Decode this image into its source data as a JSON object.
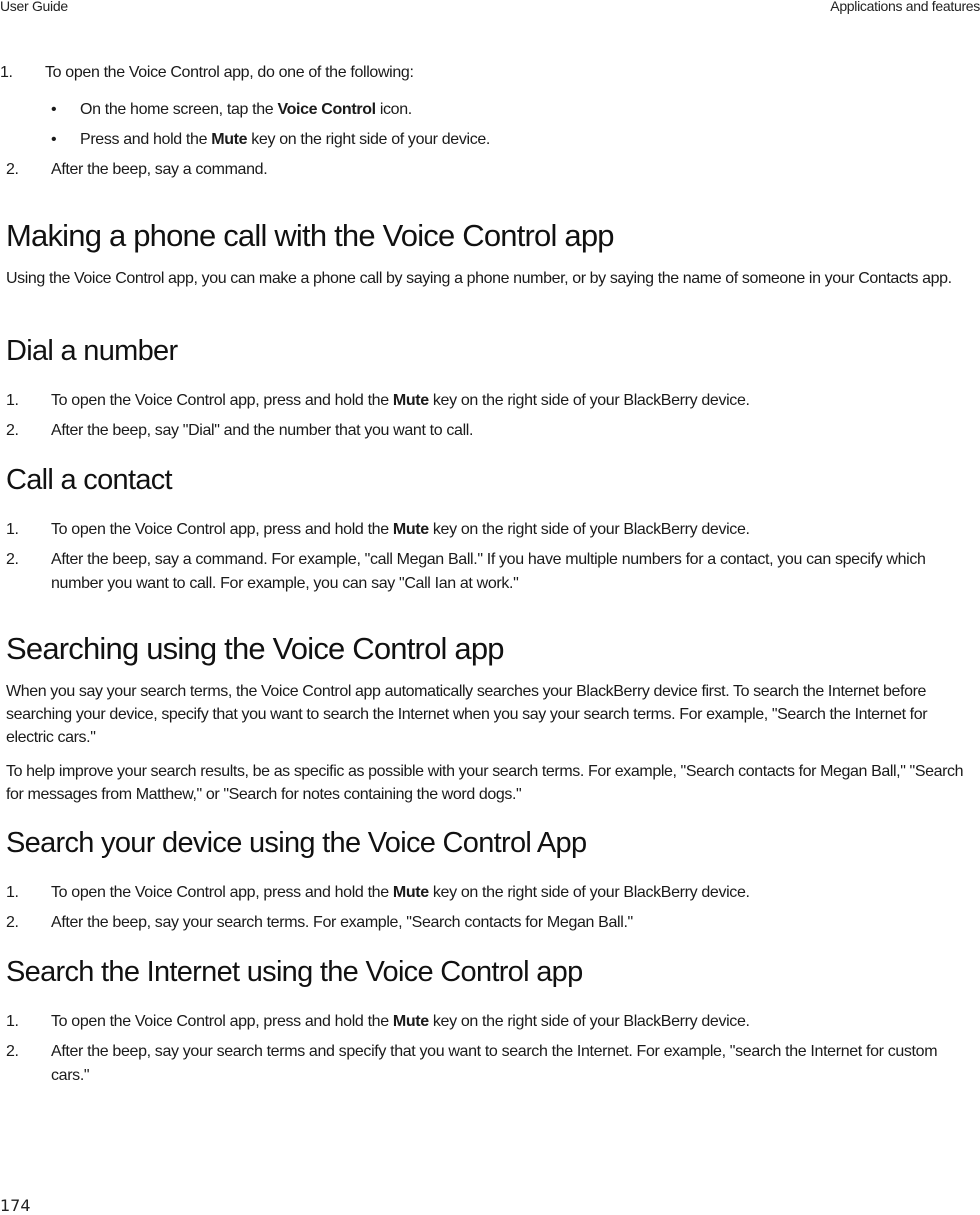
{
  "header": {
    "left": "User Guide",
    "right": "Applications and features"
  },
  "intro": {
    "steps": [
      {
        "num": "1.",
        "text": "To open the Voice Control app, do one of the following:"
      },
      {
        "num": "2.",
        "text": "After the beep, say a command."
      }
    ],
    "bullets": [
      {
        "pre": "On the home screen, tap the ",
        "bold": "Voice Control",
        "post": " icon."
      },
      {
        "pre": "Press and hold the ",
        "bold": "Mute",
        "post": " key on the right side of your device."
      }
    ],
    "bullet_char": "•"
  },
  "section_call": {
    "title": "Making a phone call with the Voice Control app",
    "description": "Using the Voice Control app, you can make a phone call by saying a phone number, or by saying the name of someone in your Contacts app.",
    "dial": {
      "title": "Dial a number",
      "steps": [
        {
          "num": "1.",
          "pre": "To open the Voice Control app, press and hold the ",
          "bold": "Mute",
          "post": " key on the right side of your BlackBerry device."
        },
        {
          "num": "2.",
          "text": "After the beep, say \"Dial\" and the number that you want to call."
        }
      ]
    },
    "contact": {
      "title": "Call a contact",
      "steps": [
        {
          "num": "1.",
          "pre": "To open the Voice Control app, press and hold the ",
          "bold": "Mute",
          "post": " key on the right side of your BlackBerry device."
        },
        {
          "num": "2.",
          "text": "After the beep, say a command. For example, \"call Megan Ball.\" If you have multiple numbers for a contact, you can specify which number you want to call. For example, you can say \"Call Ian at work.\""
        }
      ]
    }
  },
  "section_search": {
    "title": "Searching using the Voice Control app",
    "paragraphs": [
      "When you say your search terms, the Voice Control app automatically searches your BlackBerry device first. To search the Internet before searching your device, specify that you want to search the Internet when you say your search terms. For example, \"Search the Internet for electric cars.\"",
      "To help improve your search results, be as specific as possible with your search terms. For example, \"Search contacts for Megan Ball,\" \"Search for messages from Matthew,\" or \"Search for notes containing the word dogs.\""
    ],
    "device": {
      "title": "Search your device using the Voice Control App",
      "steps": [
        {
          "num": "1.",
          "pre": "To open the Voice Control app, press and hold the ",
          "bold": "Mute",
          "post": " key on the right side of your BlackBerry device."
        },
        {
          "num": "2.",
          "text": "After the beep, say your search terms. For example, \"Search contacts for Megan Ball.\""
        }
      ]
    },
    "internet": {
      "title": "Search the Internet using the Voice Control app",
      "steps": [
        {
          "num": "1.",
          "pre": "To open the Voice Control app, press and hold the ",
          "bold": "Mute",
          "post": " key on the right side of your BlackBerry device."
        },
        {
          "num": "2.",
          "text": "After the beep, say your search terms and specify that you want to search the Internet. For example, \"search the Internet for custom cars.\""
        }
      ]
    }
  },
  "footer": {
    "page_number": "174"
  }
}
